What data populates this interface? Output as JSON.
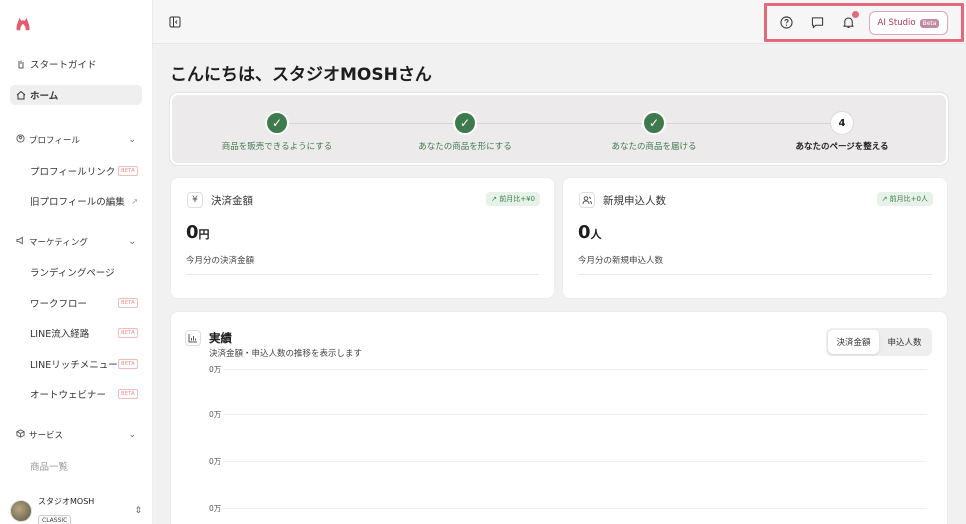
{
  "sidebar": {
    "start_guide": "スタートガイド",
    "home": "ホーム",
    "profile_group": "プロフィール",
    "profile_items": [
      {
        "label": "プロフィールリンク",
        "badge": "BETA"
      },
      {
        "label": "旧プロフィールの編集",
        "badge": ""
      }
    ],
    "marketing_group": "マーケティング",
    "marketing_items": [
      {
        "label": "ランディングページ",
        "badge": ""
      },
      {
        "label": "ワークフロー",
        "badge": "BETA"
      },
      {
        "label": "LINE流入経路",
        "badge": "BETA"
      },
      {
        "label": "LINEリッチメニュー",
        "badge": "BETA"
      },
      {
        "label": "オートウェビナー",
        "badge": "BETA"
      }
    ],
    "service_group": "サービス",
    "service_items": [
      {
        "label": "商品一覧"
      }
    ],
    "user": {
      "name": "スタジオMOSH",
      "plan": "CLASSIC"
    }
  },
  "topbar": {
    "ai_studio_label": "AI Studio",
    "ai_studio_badge": "Beta"
  },
  "main": {
    "greeting": "こんにちは、スタジオMOSHさん",
    "steps": [
      {
        "label": "商品を販売できるようにする",
        "done": true
      },
      {
        "label": "あなたの商品を形にする",
        "done": true
      },
      {
        "label": "あなたの商品を届ける",
        "done": true
      },
      {
        "label": "あなたのページを整える",
        "done": false,
        "number": "4"
      }
    ],
    "payment_card": {
      "icon": "¥",
      "title": "決済金額",
      "delta": "前月比+¥0",
      "value": "0",
      "unit": "円",
      "subtitle": "今月分の決済金額"
    },
    "signup_card": {
      "title": "新規申込人数",
      "delta": "前月比+0人",
      "value": "0",
      "unit": "人",
      "subtitle": "今月分の新規申込人数"
    },
    "performance": {
      "title": "実績",
      "subtitle": "決済金額・申込人数の推移を表示します",
      "toggle": [
        "決済金額",
        "申込人数"
      ],
      "active_toggle": "決済金額",
      "y_ticks": [
        "0万",
        "0万",
        "0万",
        "0万"
      ]
    }
  }
}
